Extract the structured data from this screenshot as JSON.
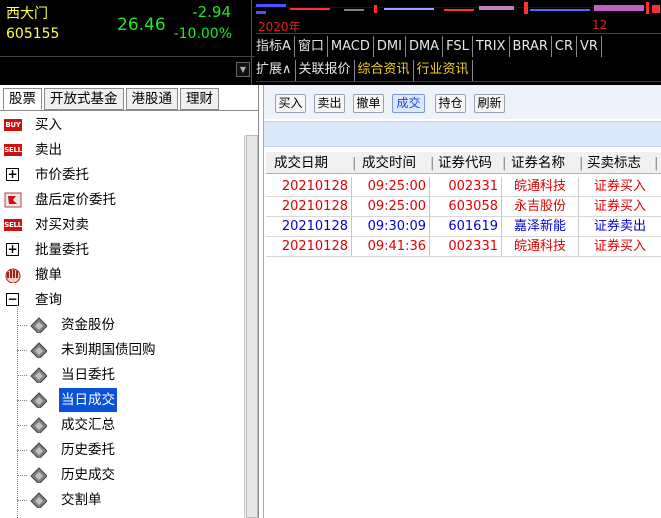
{
  "quote": {
    "name": "西大门",
    "code": "605155",
    "price": "26.46",
    "change": "-2.94",
    "change_pct": "-10.00%",
    "year_label": "2020年",
    "month_label": "12",
    "indicators": [
      "指标A",
      "窗口",
      "MACD",
      "DMI",
      "DMA",
      "FSL",
      "TRIX",
      "BRAR",
      "CR",
      "VR"
    ],
    "ext": [
      {
        "label": "扩展∧",
        "color": "#e6e6e6"
      },
      {
        "label": "关联报价",
        "color": "#e6e6e6"
      },
      {
        "label": "综合资讯",
        "color": "#f0d020"
      },
      {
        "label": "行业资讯",
        "color": "#f0d020"
      }
    ],
    "dropdown_glyph": "▼"
  },
  "left_tabs": [
    "股票",
    "开放式基金",
    "港股通",
    "理财"
  ],
  "tree": {
    "buy_badge": "BUY",
    "sell_badge": "SELL",
    "items": {
      "buy": "买入",
      "sell": "卖出",
      "market_order": "市价委托",
      "after_hours": "盘后定价委托",
      "cross_trade": "对买对卖",
      "batch": "批量委托",
      "cancel": "撤单",
      "query": "查询"
    },
    "query_children": [
      "资金股份",
      "未到期国债回购",
      "当日委托",
      "当日成交",
      "成交汇总",
      "历史委托",
      "历史成交",
      "交割单"
    ],
    "plus": "+",
    "minus": "−"
  },
  "toolbar": [
    "买入",
    "卖出",
    "撤单",
    "成交",
    "持仓",
    "刷新"
  ],
  "grid": {
    "headers": [
      "成交日期",
      "成交时间",
      "证券代码",
      "证券名称",
      "买卖标志"
    ],
    "rows": [
      {
        "date": "20210128",
        "time": "09:25:00",
        "code": "002331",
        "name": "皖通科技",
        "side": "证券买入",
        "type": "buy"
      },
      {
        "date": "20210128",
        "time": "09:25:00",
        "code": "603058",
        "name": "永吉股份",
        "side": "证券买入",
        "type": "buy"
      },
      {
        "date": "20210128",
        "time": "09:30:09",
        "code": "601619",
        "name": "嘉泽新能",
        "side": "证券卖出",
        "type": "sell"
      },
      {
        "date": "20210128",
        "time": "09:41:36",
        "code": "002331",
        "name": "皖通科技",
        "side": "证券买入",
        "type": "buy"
      }
    ]
  }
}
